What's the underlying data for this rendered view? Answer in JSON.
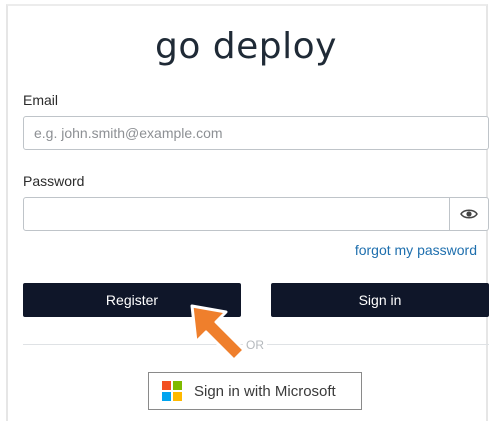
{
  "app": {
    "title": "go deploy"
  },
  "form": {
    "email_label": "Email",
    "email_placeholder": "e.g. john.smith@example.com",
    "email_value": "",
    "password_label": "Password",
    "password_value": "",
    "forgot_link": "forgot my password"
  },
  "actions": {
    "register_label": "Register",
    "signin_label": "Sign in",
    "divider_text": "OR",
    "microsoft_label": "Sign in with Microsoft"
  },
  "icons": {
    "show_password": "eye-icon",
    "microsoft_logo": "microsoft-logo-icon",
    "pointer_annotation": "arrow-icon"
  },
  "colors": {
    "primary_button": "#0f1629",
    "link": "#1e6fae",
    "annotation_arrow": "#ef7f2c",
    "ms_red": "#f25022",
    "ms_green": "#7fba00",
    "ms_blue": "#00a4ef",
    "ms_yellow": "#ffb900"
  }
}
